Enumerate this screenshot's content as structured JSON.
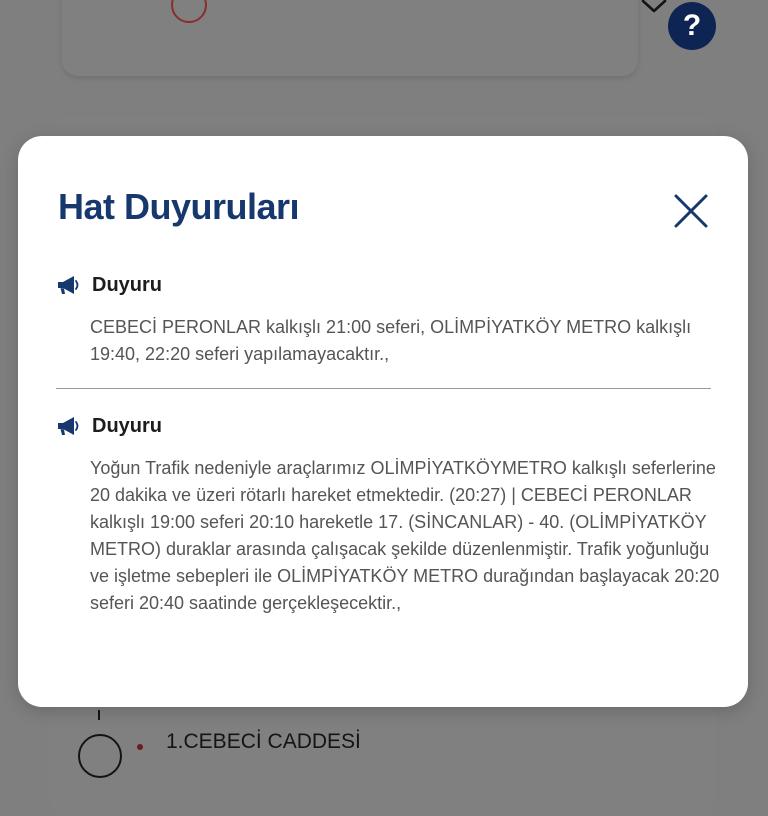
{
  "background": {
    "help_button_label": "?",
    "stop": {
      "name": "1.CEBECİ CADDESİ"
    }
  },
  "modal": {
    "title": "Hat Duyuruları",
    "announcements": [
      {
        "label": "Duyuru",
        "text": "CEBECİ PERONLAR kalkışlı 21:00 seferi, OLİMPİYATKÖY METRO kalkışlı 19:40, 22:20 seferi yapılamayacaktır.,"
      },
      {
        "label": "Duyuru",
        "text": "Yoğun Trafik nedeniyle araçlarımız OLİMPİYATKÖYMETRO kalkışlı seferlerine 20 dakika ve üzeri rötarlı hareket etmektedir. (20:27) | CEBECİ PERONLAR kalkışlı 19:00 seferi 20:10 hareketle 17. (SİNCANLAR) - 40. (OLİMPİYATKÖY METRO) duraklar arasında çalışacak şekilde düzenlenmiştir. Trafik yoğunluğu ve işletme sebepleri ile OLİMPİYATKÖY METRO durağından başlayacak 20:20 seferi 20:40 saatinde gerçekleşecektir.,"
      }
    ]
  },
  "icons": {
    "close": "close-icon",
    "announcement": "megaphone-icon",
    "dropdown": "chevron-down-icon",
    "help": "help-icon"
  },
  "colors": {
    "overlay": "#7f7f7f",
    "title": "#17386f",
    "help_button": "#0e2553",
    "body_text": "#555555"
  }
}
